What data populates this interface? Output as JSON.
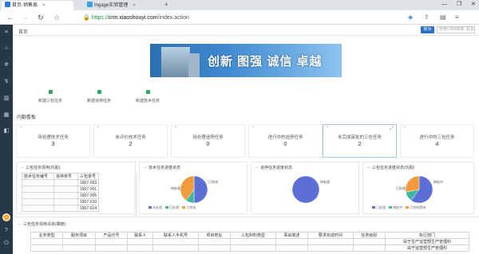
{
  "browser": {
    "tabs": [
      {
        "label": "首页-销售易",
        "active": true
      },
      {
        "label": "Ingage实验管理",
        "active": false
      }
    ],
    "new_tab": "+",
    "url_scheme": "https://",
    "url_host": "crm.xiaoshouyi.com",
    "url_path": "/index.action"
  },
  "app": {
    "breadcrumb": "首页",
    "tag_button": "新功",
    "search_placeholder": "搜索CRM数据, 联系人",
    "banner_slogan": "创新 图强 诚信 卓越",
    "quick_actions": [
      "新建三包任务",
      "新建追停任务",
      "新建技术任务"
    ],
    "section_title": "内勤看板",
    "kpis": [
      {
        "label": "待处理技术任务",
        "value": "3"
      },
      {
        "label": "未评价技术任务",
        "value": "2"
      },
      {
        "label": "待处理追停任务",
        "value": "0"
      },
      {
        "label": "进行中的追停任务",
        "value": "0"
      },
      {
        "label": "未完成审批的三包任务",
        "value": "2"
      },
      {
        "label": "进行中的三包任务",
        "value": "4"
      }
    ],
    "tech_panel": {
      "title": "三包任务领用(内勤)",
      "headers": [
        "技术任务编号",
        "追停单号",
        "三包单号"
      ],
      "rows": [
        [
          "",
          "",
          "1907-003"
        ],
        [
          "",
          "",
          "1907-001"
        ],
        [
          "",
          "",
          "1907-005"
        ],
        [
          "",
          "",
          "1907-010"
        ],
        [
          "",
          "",
          "1907-014"
        ]
      ]
    },
    "charts": [
      {
        "title": "技术任务进度状态",
        "legend": [
          "未处理",
          "已处理",
          "已完成"
        ],
        "colors": [
          "#5b6fd6",
          "#3fb8a0",
          "#f29b3a"
        ]
      },
      {
        "title": "追停任务进度状态",
        "legend": [
          "未处理"
        ],
        "colors": [
          "#5b6fd6"
        ]
      },
      {
        "title": "三包任务进度状态(内勤)",
        "legend": [
          "已处理",
          "审批中",
          "已完成等待"
        ],
        "colors": [
          "#5b6fd6",
          "#3fb8a0",
          "#f29b3a"
        ]
      }
    ],
    "chart_data": [
      {
        "type": "pie",
        "title": "技术任务进度状态",
        "labels": [
          "未处理",
          "已处理",
          "已完成"
        ],
        "values": [
          50,
          10,
          40
        ]
      },
      {
        "type": "pie",
        "title": "追停任务进度状态",
        "labels": [
          "未处理"
        ],
        "values": [
          100
        ]
      },
      {
        "type": "pie",
        "title": "三包任务进度状态(内勤)",
        "labels": [
          "已处理",
          "审批中",
          "已完成等待"
        ],
        "values": [
          60,
          12,
          28
        ]
      }
    ],
    "pie_labels": [
      {
        "left": "待处理",
        "right": "已完成"
      },
      {
        "left": "",
        "right": "待处理"
      },
      {
        "left": "已处理",
        "right": "审批中"
      }
    ],
    "task_panel": {
      "title": "三包任务领用清单(确度)",
      "headers": [
        "业务类型",
        "服务项目",
        "产品代号",
        "联系人",
        "联系人手机号",
        "项目地址",
        "三包材料类型",
        "事由简述",
        "要求完成时间",
        "任务级别",
        "执行部门"
      ],
      "rows": [
        [
          "",
          "",
          "",
          "",
          "",
          "",
          "",
          "",
          "",
          "",
          "由于生产运营部生产管理科"
        ],
        [
          "",
          "",
          "",
          "",
          "",
          "",
          "",
          "",
          "",
          "",
          "由于运营部生产管理科"
        ]
      ]
    }
  }
}
